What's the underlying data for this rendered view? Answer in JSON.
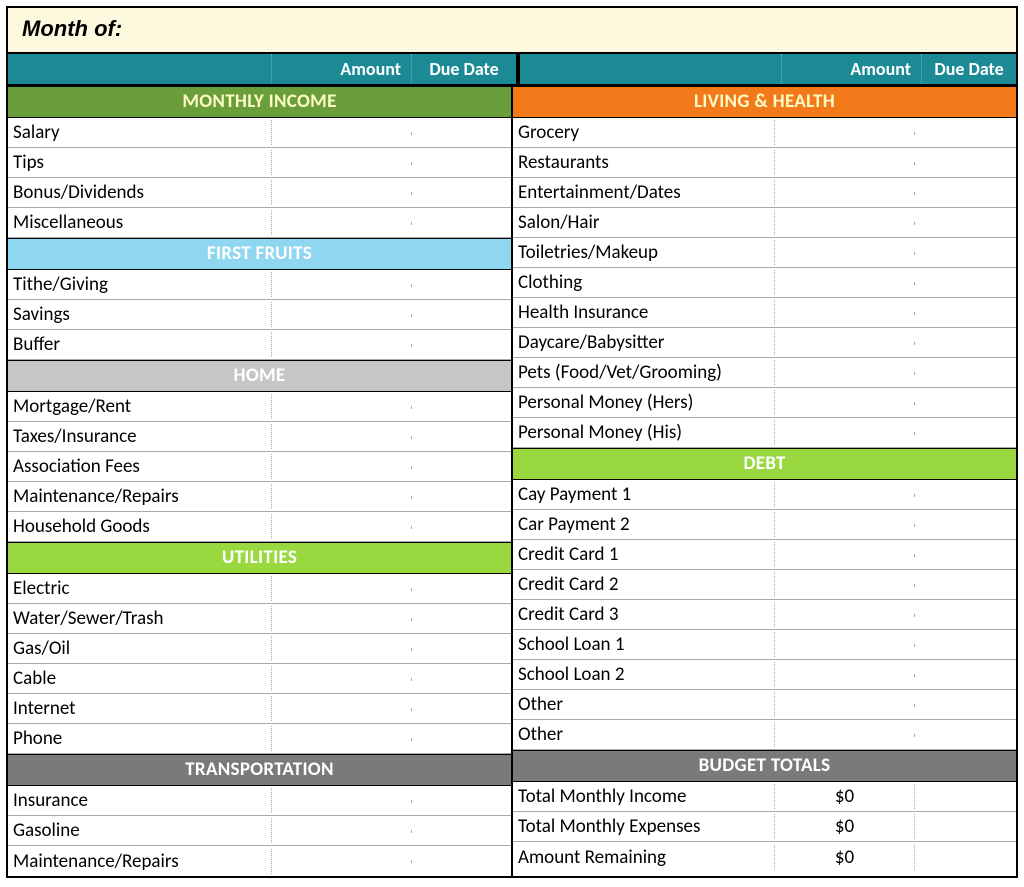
{
  "title": "Month of:",
  "headers": {
    "amount": "Amount",
    "due_date": "Due Date"
  },
  "left": {
    "sections": [
      {
        "title": "MONTHLY INCOME",
        "style": "sh-green-dark",
        "rows": [
          "Salary",
          "Tips",
          "Bonus/Dividends",
          "Miscellaneous"
        ]
      },
      {
        "title": "FIRST FRUITS",
        "style": "sh-cyan",
        "rows": [
          "Tithe/Giving",
          "Savings",
          "Buffer"
        ]
      },
      {
        "title": "HOME",
        "style": "sh-gray",
        "rows": [
          "Mortgage/Rent",
          "Taxes/Insurance",
          "Association Fees",
          "Maintenance/Repairs",
          "Household Goods"
        ]
      },
      {
        "title": "UTILITIES",
        "style": "sh-lime",
        "rows": [
          "Electric",
          "Water/Sewer/Trash",
          "Gas/Oil",
          "Cable",
          "Internet",
          "Phone"
        ]
      },
      {
        "title": "TRANSPORTATION",
        "style": "sh-darkgray",
        "rows": [
          "Insurance",
          "Gasoline",
          "Maintenance/Repairs"
        ]
      }
    ]
  },
  "right": {
    "sections": [
      {
        "title": "LIVING & HEALTH",
        "style": "sh-orange",
        "rows": [
          "Grocery",
          "Restaurants",
          "Entertainment/Dates",
          "Salon/Hair",
          "Toiletries/Makeup",
          "Clothing",
          "Health Insurance",
          "Daycare/Babysitter",
          "Pets (Food/Vet/Grooming)",
          "Personal Money (Hers)",
          "Personal Money (His)"
        ]
      },
      {
        "title": "DEBT",
        "style": "sh-lime",
        "rows": [
          "Cay Payment 1",
          "Car Payment 2",
          "Credit Card 1",
          "Credit Card 2",
          "Credit Card 3",
          "School Loan 1",
          "School Loan 2",
          "Other",
          "Other"
        ]
      }
    ],
    "totals": {
      "title": "BUDGET TOTALS",
      "style": "sh-darkgray",
      "rows": [
        {
          "label": "Total Monthly Income",
          "value": "$0"
        },
        {
          "label": "Total Monthly Expenses",
          "value": "$0"
        },
        {
          "label": "Amount Remaining",
          "value": "$0"
        }
      ]
    }
  }
}
